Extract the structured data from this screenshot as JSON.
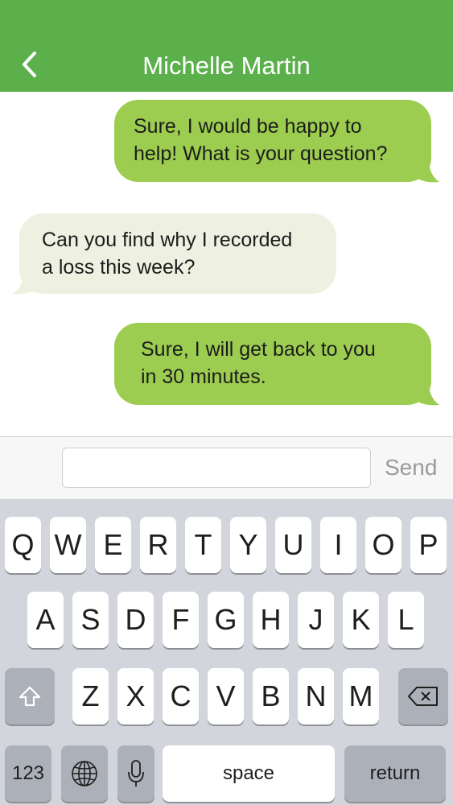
{
  "header": {
    "title": "Michelle Martin",
    "back_icon": "chevron-left-icon"
  },
  "colors": {
    "header_bg": "#5bb04c",
    "outgoing_bubble": "#9ccd50",
    "incoming_bubble": "#eef1e1",
    "keyboard_bg": "#d2d5db"
  },
  "messages": [
    {
      "direction": "outgoing",
      "text": "Sure, I would be happy to\nhelp!  What is your question?"
    },
    {
      "direction": "incoming",
      "text": "Can you find why I recorded\na loss this week?"
    },
    {
      "direction": "outgoing",
      "text": "Sure, I will get back to you\nin 30 minutes."
    }
  ],
  "composer": {
    "placeholder": "",
    "value": "",
    "send_label": "Send"
  },
  "keyboard": {
    "row1": [
      "Q",
      "W",
      "E",
      "R",
      "T",
      "Y",
      "U",
      "I",
      "O",
      "P"
    ],
    "row2": [
      "A",
      "S",
      "D",
      "F",
      "G",
      "H",
      "J",
      "K",
      "L"
    ],
    "row3": [
      "Z",
      "X",
      "C",
      "V",
      "B",
      "N",
      "M"
    ],
    "shift_icon": "shift-icon",
    "delete_icon": "backspace-icon",
    "numbers_label": "123",
    "globe_icon": "globe-icon",
    "mic_icon": "microphone-icon",
    "space_label": "space",
    "return_label": "return"
  }
}
